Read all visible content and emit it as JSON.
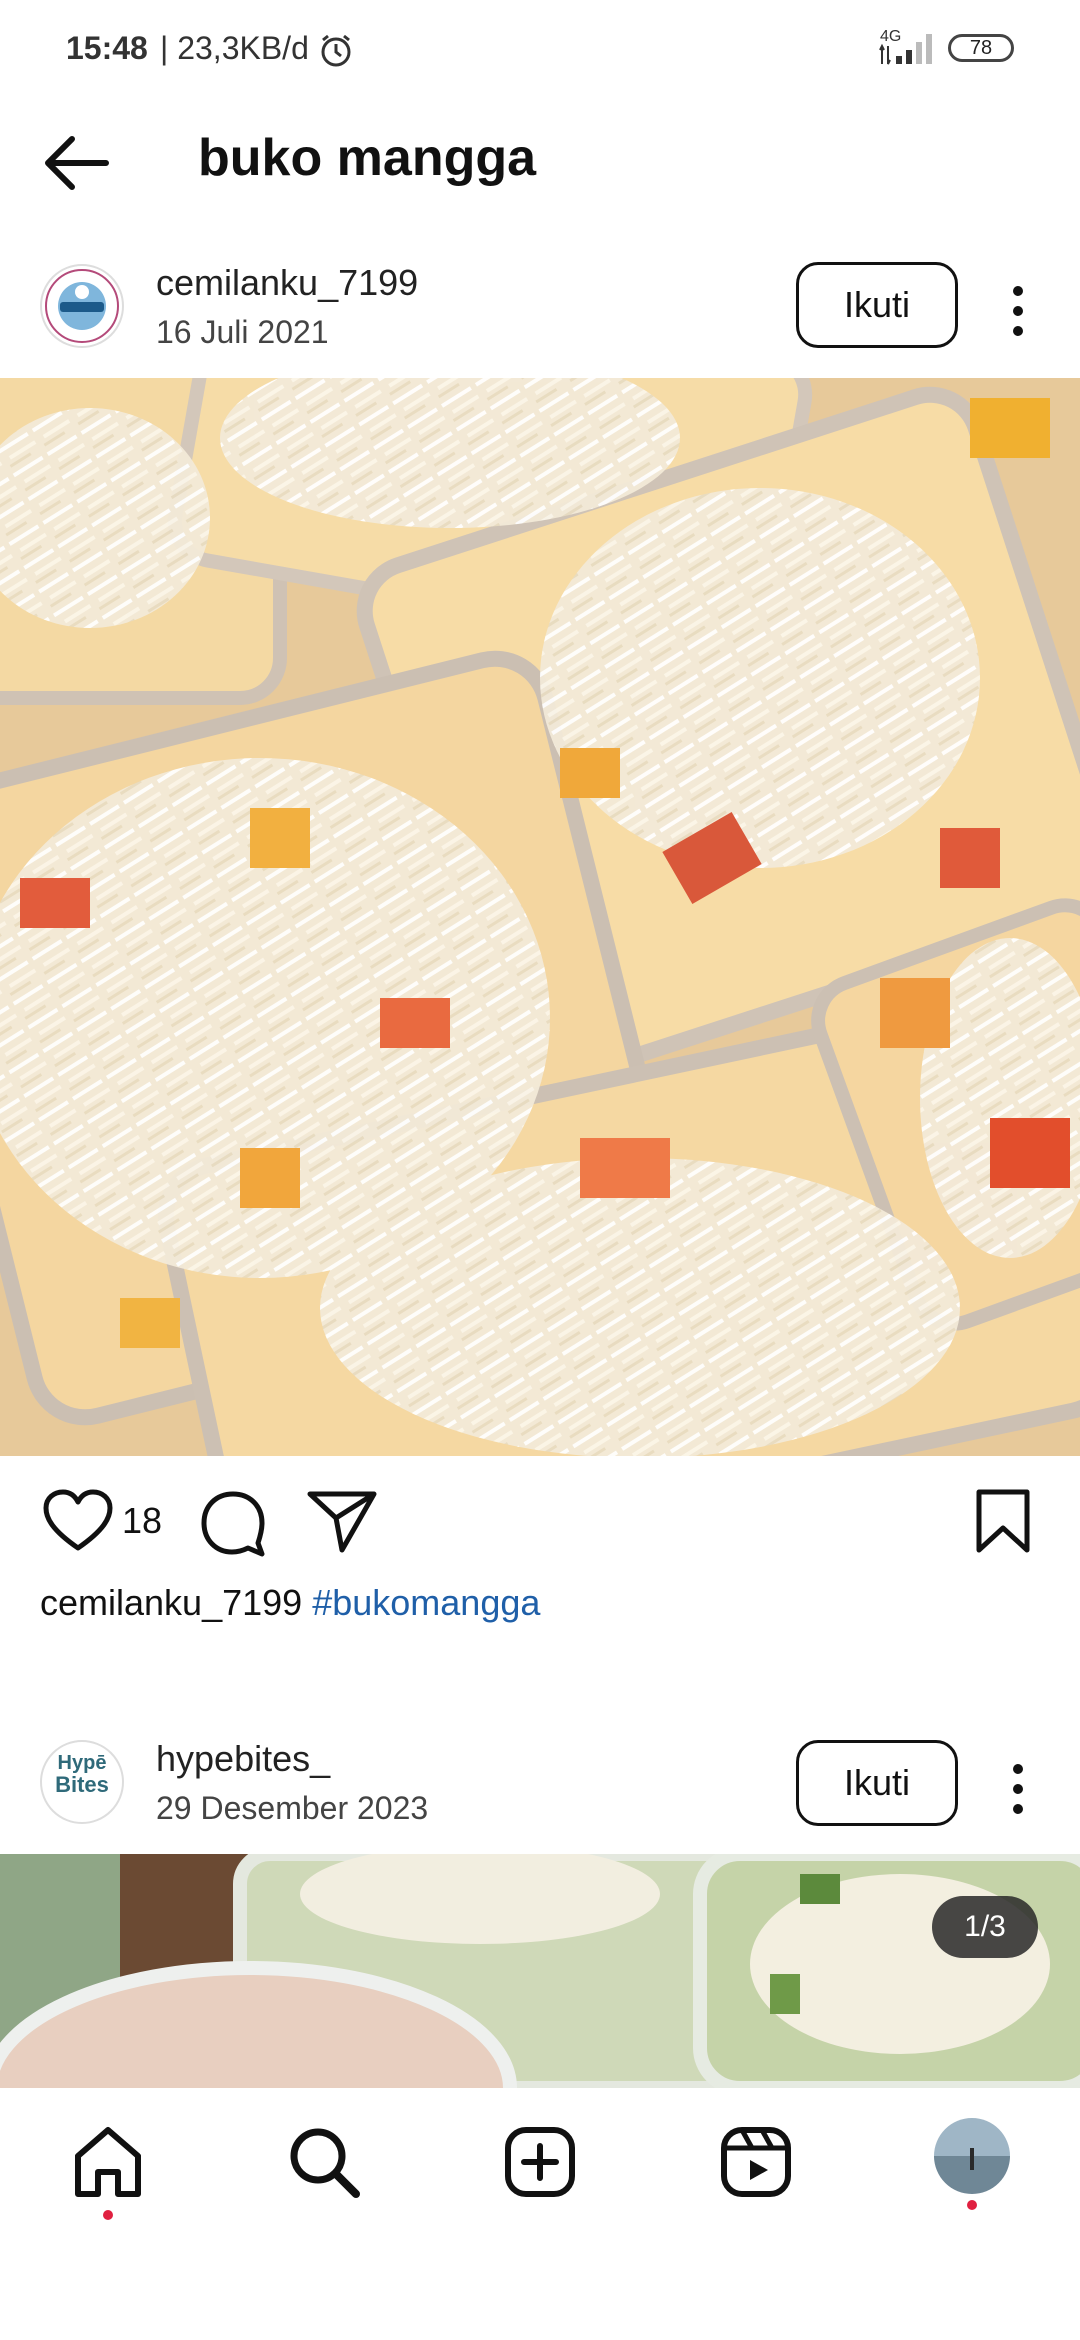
{
  "status_bar": {
    "time": "15:48",
    "network_speed": "| 23,3KB/d",
    "signal_label": "4G",
    "battery": "78"
  },
  "header": {
    "title": "buko mangga"
  },
  "posts": [
    {
      "username": "cemilanku_7199",
      "date": "16 Juli 2021",
      "follow_label": "Ikuti",
      "likes": "18",
      "caption_user": "cemilanku_7199",
      "caption_hashtag": "#bukomangga"
    },
    {
      "username": "hypebites_",
      "date": "29 Desember 2023",
      "follow_label": "Ikuti",
      "avatar_text_1": "Hypē",
      "avatar_text_2": "Bites",
      "image_counter": "1/3"
    }
  ],
  "nav": {
    "items": [
      "home-icon",
      "search-icon",
      "create-icon",
      "reels-icon",
      "profile-avatar"
    ]
  },
  "colors": {
    "hashtag": "#1f5fa8",
    "notification_dot": "#e02040"
  }
}
